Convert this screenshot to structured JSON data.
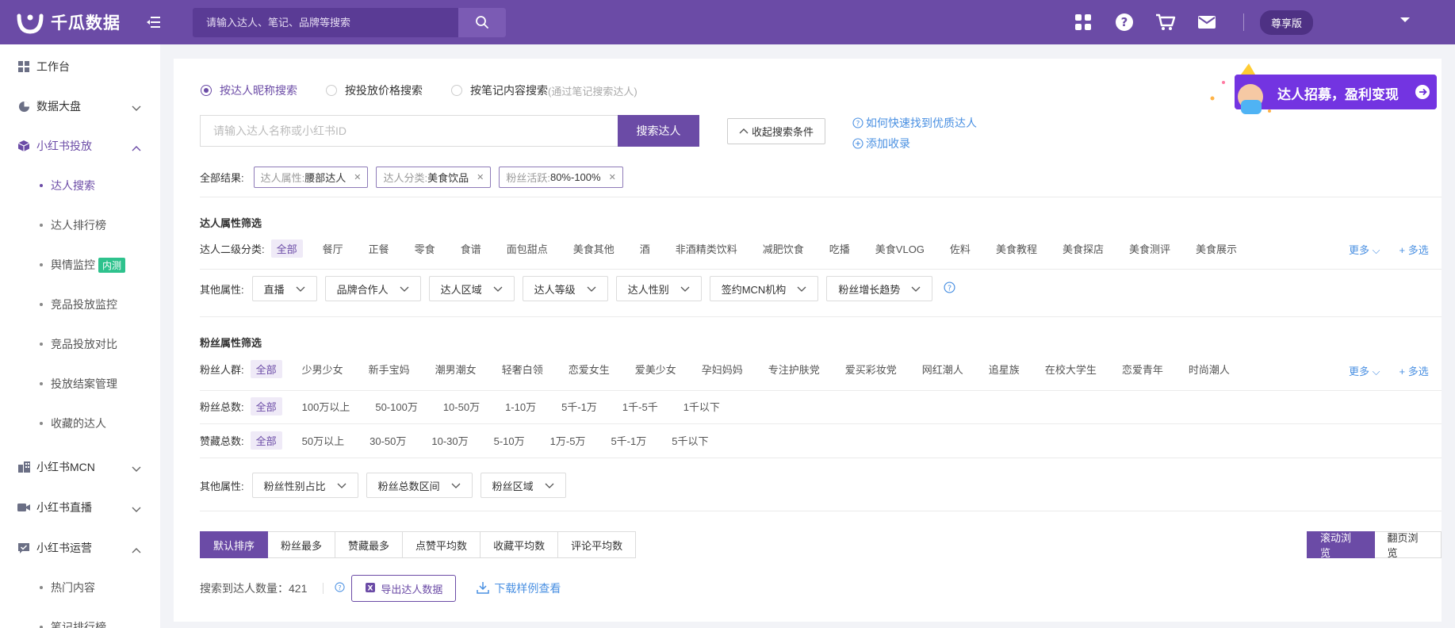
{
  "brand": {
    "name": "千瓜数据"
  },
  "search": {
    "placeholder": "请输入达人、笔记、品牌等搜索"
  },
  "header": {
    "plan": "尊享版"
  },
  "sidebar": {
    "items": [
      {
        "label": "工作台",
        "icon": "grid-icon"
      },
      {
        "label": "数据大盘",
        "icon": "pie-chart-icon"
      },
      {
        "label": "小红书投放",
        "icon": "cube-icon"
      },
      {
        "label": "达人搜索"
      },
      {
        "label": "达人排行榜"
      },
      {
        "label": "舆情监控",
        "badge": "内测"
      },
      {
        "label": "竞品投放监控"
      },
      {
        "label": "竞品投放对比"
      },
      {
        "label": "投放结案管理"
      },
      {
        "label": "收藏的达人"
      },
      {
        "label": "小红书MCN",
        "icon": "building-icon"
      },
      {
        "label": "小红书直播",
        "icon": "video-icon"
      },
      {
        "label": "小红书运营",
        "icon": "chat-check-icon"
      },
      {
        "label": "热门内容"
      },
      {
        "label": "笔记排行榜"
      }
    ]
  },
  "mode": {
    "options": [
      "按达人昵称搜索",
      "按投放价格搜索",
      "按笔记内容搜索"
    ],
    "note": "(通过笔记搜索达人)"
  },
  "keyword": {
    "placeholder": "请输入达人名称或小红书ID",
    "button": "搜索达人",
    "collapse": "收起搜索条件",
    "help1": "如何快速找到优质达人",
    "help2": "添加收录"
  },
  "banner": {
    "text": "达人招募，盈利变现"
  },
  "results": {
    "label": "全部结果:",
    "tags": [
      {
        "k": "达人属性:",
        "v": "腰部达人"
      },
      {
        "k": "达人分类:",
        "v": "美食饮品"
      },
      {
        "k": "粉丝活跃:",
        "v": "80%-100%"
      }
    ]
  },
  "kol_filter": {
    "title": "达人属性筛选",
    "sub_label": "达人二级分类:",
    "sub_options": [
      "全部",
      "餐厅",
      "正餐",
      "零食",
      "食谱",
      "面包甜点",
      "美食其他",
      "酒",
      "非酒精类饮料",
      "减肥饮食",
      "吃播",
      "美食VLOG",
      "佐料",
      "美食教程",
      "美食探店",
      "美食测评",
      "美食展示"
    ],
    "more": "更多",
    "multi": "+ 多选",
    "other_label": "其他属性:",
    "other_options": [
      "直播",
      "品牌合作人",
      "达人区域",
      "达人等级",
      "达人性别",
      "签约MCN机构",
      "粉丝增长趋势"
    ]
  },
  "fan_filter": {
    "title": "粉丝属性筛选",
    "crowd_label": "粉丝人群:",
    "crowd_options": [
      "全部",
      "少男少女",
      "新手宝妈",
      "潮男潮女",
      "轻奢白领",
      "恋爱女生",
      "爱美少女",
      "孕妇妈妈",
      "专注护肤党",
      "爱买彩妆党",
      "网红潮人",
      "追星族",
      "在校大学生",
      "恋爱青年",
      "时尚潮人"
    ],
    "total_label": "粉丝总数:",
    "total_options": [
      "全部",
      "100万以上",
      "50-100万",
      "10-50万",
      "1-10万",
      "5千-1万",
      "1千-5千",
      "1千以下"
    ],
    "likes_label": "赞藏总数:",
    "likes_options": [
      "全部",
      "50万以上",
      "30-50万",
      "10-30万",
      "5-10万",
      "1万-5万",
      "5千-1万",
      "5千以下"
    ],
    "other_label": "其他属性:",
    "other_options": [
      "粉丝性别占比",
      "粉丝总数区间",
      "粉丝区域"
    ],
    "more": "更多",
    "multi": "+ 多选"
  },
  "sort": {
    "options": [
      "默认排序",
      "粉丝最多",
      "赞藏最多",
      "点赞平均数",
      "收藏平均数",
      "评论平均数"
    ],
    "views": [
      "滚动浏览",
      "翻页浏览"
    ]
  },
  "footer": {
    "count_label": "搜索到达人数量：",
    "count": "421",
    "export": "导出达人数据",
    "download": "下载样例查看"
  },
  "colors": {
    "brand": "#6b4ba6",
    "link": "#4a90e2",
    "beta": "#2ec28d"
  }
}
